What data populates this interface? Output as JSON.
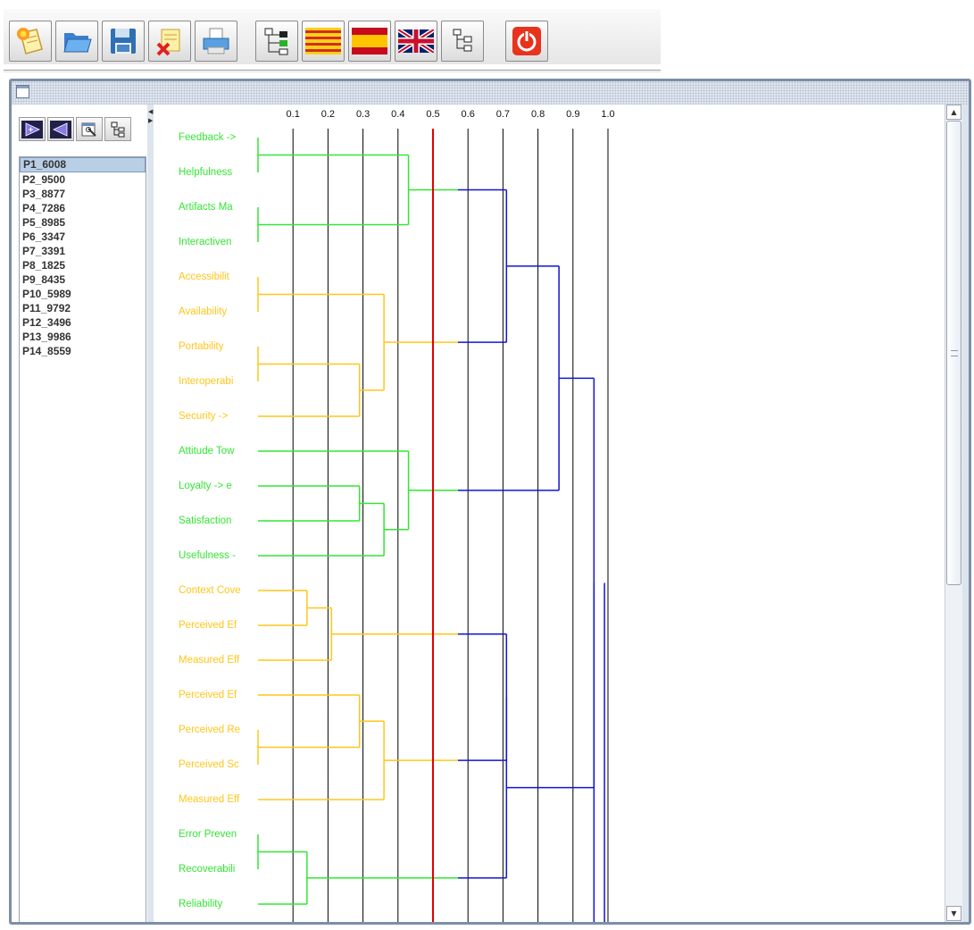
{
  "toolbar": {
    "buttons": [
      {
        "name": "new-project",
        "icon": "new-project-icon"
      },
      {
        "name": "open",
        "icon": "folder-icon"
      },
      {
        "name": "save",
        "icon": "floppy-disk-icon"
      },
      {
        "name": "close-project",
        "icon": "close-project-icon"
      },
      {
        "name": "print",
        "icon": "printer-icon"
      },
      {
        "name": "tree-view",
        "icon": "tree-structure-icon"
      },
      {
        "name": "language-catalan",
        "icon": "catalan-flag-icon"
      },
      {
        "name": "language-spanish",
        "icon": "spanish-flag-icon"
      },
      {
        "name": "language-english",
        "icon": "uk-flag-icon"
      },
      {
        "name": "hierarchy",
        "icon": "hierarchy-icon"
      },
      {
        "name": "exit",
        "icon": "power-icon"
      }
    ]
  },
  "left_panel": {
    "tools": [
      {
        "name": "expand",
        "icon": "purple-right-arrow-icon"
      },
      {
        "name": "collapse",
        "icon": "purple-left-arrow-icon"
      },
      {
        "name": "properties",
        "icon": "properties-icon"
      },
      {
        "name": "tree",
        "icon": "tree-icon"
      }
    ],
    "participants": [
      "P1_6008",
      "P2_9500",
      "P3_8877",
      "P4_7286",
      "P5_8985",
      "P6_3347",
      "P7_3391",
      "P8_1825",
      "P9_8435",
      "P10_5989",
      "P11_9792",
      "P12_3496",
      "P13_9986",
      "P14_8559"
    ],
    "selected": "P1_6008"
  },
  "chart_data": {
    "type": "dendrogram",
    "axis_ticks": [
      "0.1",
      "0.2",
      "0.3",
      "0.4",
      "0.5",
      "0.6",
      "0.7",
      "0.8",
      "0.9",
      "1.0"
    ],
    "cut_threshold": 0.5,
    "leaves": [
      {
        "label": "Feedback ->",
        "group": "green"
      },
      {
        "label": "Helpfulness",
        "group": "green"
      },
      {
        "label": "Artifacts Ma",
        "group": "green"
      },
      {
        "label": "Interactiven",
        "group": "green"
      },
      {
        "label": "Accessibilit",
        "group": "yellow"
      },
      {
        "label": "Availability",
        "group": "yellow"
      },
      {
        "label": "Portability",
        "group": "yellow"
      },
      {
        "label": "Interoperabi",
        "group": "yellow"
      },
      {
        "label": "Security ->",
        "group": "yellow"
      },
      {
        "label": "Attitude Tow",
        "group": "green"
      },
      {
        "label": "Loyalty -> e",
        "group": "green"
      },
      {
        "label": "Satisfaction",
        "group": "green"
      },
      {
        "label": "Usefulness -",
        "group": "green"
      },
      {
        "label": "Context Cove",
        "group": "yellow"
      },
      {
        "label": "Perceived Ef",
        "group": "yellow"
      },
      {
        "label": "Measured Eff",
        "group": "yellow"
      },
      {
        "label": "Perceived Ef",
        "group": "yellow"
      },
      {
        "label": "Perceived Re",
        "group": "yellow"
      },
      {
        "label": "Perceived Sc",
        "group": "yellow"
      },
      {
        "label": "Measured Eff",
        "group": "yellow"
      },
      {
        "label": "Error Preven",
        "group": "green"
      },
      {
        "label": "Recoverabili",
        "group": "green"
      },
      {
        "label": "Reliability",
        "group": "green"
      }
    ],
    "merges": [
      {
        "a": "L0",
        "b": "L1",
        "h": 0.0
      },
      {
        "a": "L2",
        "b": "L3",
        "h": 0.0
      },
      {
        "a": "N0",
        "b": "N1",
        "h": 0.43
      },
      {
        "a": "L4",
        "b": "L5",
        "h": 0.0
      },
      {
        "a": "L6",
        "b": "L7",
        "h": 0.0
      },
      {
        "a": "N4",
        "b": "L8",
        "h": 0.29
      },
      {
        "a": "N3",
        "b": "N5",
        "h": 0.36
      },
      {
        "a": "N2",
        "b": "N6",
        "h": 0.71
      },
      {
        "a": "L10",
        "b": "L11",
        "h": 0.29
      },
      {
        "a": "N8",
        "b": "L12",
        "h": 0.36
      },
      {
        "a": "L9",
        "b": "N9",
        "h": 0.43
      },
      {
        "a": "N7",
        "b": "N10",
        "h": 0.86
      },
      {
        "a": "L13",
        "b": "L14",
        "h": 0.14
      },
      {
        "a": "N12",
        "b": "L15",
        "h": 0.21
      },
      {
        "a": "L17",
        "b": "L18",
        "h": 0.0
      },
      {
        "a": "L16",
        "b": "N14",
        "h": 0.29
      },
      {
        "a": "N15",
        "b": "L19",
        "h": 0.36
      },
      {
        "a": "N13",
        "b": "N16",
        "h": 0.71
      },
      {
        "a": "L20",
        "b": "L21",
        "h": 0.0
      },
      {
        "a": "N18",
        "b": "L22",
        "h": 0.14
      },
      {
        "a": "N17",
        "b": "N19",
        "h": 0.71
      },
      {
        "a": "N11",
        "b": "N20",
        "h": 0.96
      },
      {
        "a": "N21",
        "b": "N21",
        "h": 0.99
      }
    ],
    "colors": {
      "green": "#33e633",
      "yellow": "#ffc61a",
      "blue": "#1414d2",
      "cut": "#e00000",
      "grid": "#000000"
    }
  }
}
